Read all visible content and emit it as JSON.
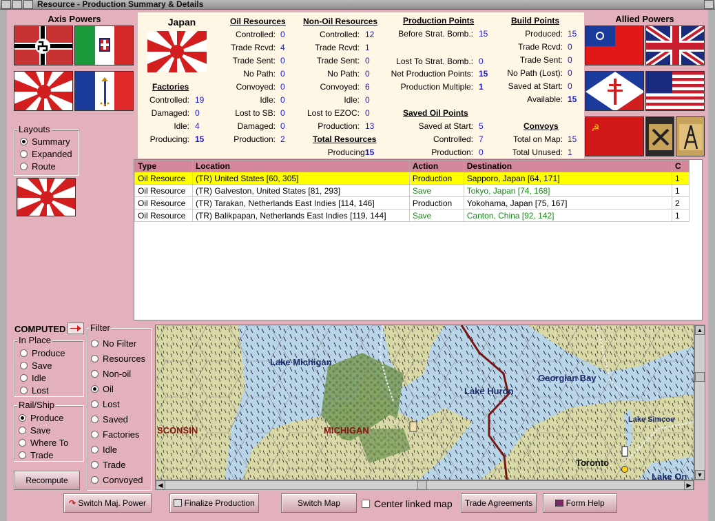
{
  "window": {
    "title": "Resource - Production Summary & Details"
  },
  "axis": {
    "header": "Axis Powers"
  },
  "allied": {
    "header": "Allied Powers"
  },
  "nation": {
    "name": "Japan"
  },
  "layouts": {
    "title": "Layouts",
    "options": [
      "Summary",
      "Expanded",
      "Route"
    ],
    "selected": 0
  },
  "factories": {
    "title": "Factories",
    "rows": [
      {
        "label": "Controlled:",
        "value": "19"
      },
      {
        "label": "Damaged:",
        "value": "0"
      },
      {
        "label": "Idle:",
        "value": "4"
      },
      {
        "label": "Producing:",
        "value": "15"
      }
    ]
  },
  "oil": {
    "title": "Oil Resources",
    "rows": [
      {
        "label": "Controlled:",
        "value": "0"
      },
      {
        "label": "Trade Rcvd:",
        "value": "4"
      },
      {
        "label": "Trade Sent:",
        "value": "0"
      },
      {
        "label": "No Path:",
        "value": "0"
      },
      {
        "label": "Convoyed:",
        "value": "0"
      },
      {
        "label": "Idle:",
        "value": "0"
      },
      {
        "label": "Lost to SB:",
        "value": "0"
      },
      {
        "label": "Damaged:",
        "value": "0"
      },
      {
        "label": "Production:",
        "value": "2"
      }
    ]
  },
  "nonoil": {
    "title": "Non-Oil Resources",
    "rows": [
      {
        "label": "Controlled:",
        "value": "12"
      },
      {
        "label": "Trade Rcvd:",
        "value": "1"
      },
      {
        "label": "Trade Sent:",
        "value": "0"
      },
      {
        "label": "No Path:",
        "value": "0"
      },
      {
        "label": "Convoyed:",
        "value": "6"
      },
      {
        "label": "Idle:",
        "value": "0"
      },
      {
        "label": "Lost to EZOC:",
        "value": "0"
      },
      {
        "label": "Production:",
        "value": "13"
      }
    ]
  },
  "total": {
    "title": "Total Resources",
    "label": "Producing:",
    "value": "15"
  },
  "prodpoints": {
    "title": "Production Points",
    "rows": [
      {
        "label": "Before Strat. Bomb.:",
        "value": "15"
      },
      {
        "label": "Lost To Strat. Bomb.:",
        "value": "0"
      },
      {
        "label": "Net Production Points:",
        "value": "15"
      },
      {
        "label": "Production Multiple:",
        "value": "1"
      }
    ]
  },
  "savedoil": {
    "title": "Saved Oil Points",
    "rows": [
      {
        "label": "Saved at Start:",
        "value": "5"
      },
      {
        "label": "Controlled:",
        "value": "7"
      },
      {
        "label": "Production:",
        "value": "0"
      }
    ]
  },
  "buildpoints": {
    "title": "Build Points",
    "rows": [
      {
        "label": "Produced:",
        "value": "15"
      },
      {
        "label": "Trade Rcvd:",
        "value": "0"
      },
      {
        "label": "Trade Sent:",
        "value": "0"
      },
      {
        "label": "No Path (Lost):",
        "value": "0"
      },
      {
        "label": "Saved at Start:",
        "value": "0"
      },
      {
        "label": "Available:",
        "value": "15"
      }
    ]
  },
  "convoys": {
    "title": "Convoys",
    "rows": [
      {
        "label": "Total on Map:",
        "value": "15"
      },
      {
        "label": "Total Unused:",
        "value": "1"
      }
    ]
  },
  "table": {
    "headers": [
      "Type",
      "Location",
      "Action",
      "Destination",
      "C"
    ],
    "rows": [
      {
        "type": "Oil Resource",
        "location": "(TR) United States [60, 305]",
        "action": "Production",
        "destination": "Sapporo, Japan [64, 171]",
        "c": "1",
        "selected": true,
        "green": false
      },
      {
        "type": "Oil Resource",
        "location": "(TR) Galveston, United States [81, 293]",
        "action": "Save",
        "destination": "Tokyo, Japan [74, 168]",
        "c": "1",
        "selected": false,
        "green": true
      },
      {
        "type": "Oil Resource",
        "location": "(TR) Tarakan, Netherlands East Indies [114, 146]",
        "action": "Production",
        "destination": "Yokohama, Japan [75, 167]",
        "c": "2",
        "selected": false,
        "green": false
      },
      {
        "type": "Oil Resource",
        "location": "(TR) Balikpapan, Netherlands East Indies [119, 144]",
        "action": "Save",
        "destination": "Canton, China [92, 142]",
        "c": "1",
        "selected": false,
        "green": true
      }
    ]
  },
  "computed": {
    "label": "COMPUTED"
  },
  "inplace": {
    "title": "In Place",
    "options": [
      "Produce",
      "Save",
      "Idle",
      "Lost"
    ]
  },
  "railship": {
    "title": "Rail/Ship",
    "options": [
      "Produce",
      "Save",
      "Where To",
      "Trade"
    ],
    "selected": 0
  },
  "filter": {
    "title": "Filter",
    "options": [
      "No Filter",
      "Resources",
      "Non-oil",
      "Oil",
      "Lost",
      "Saved",
      "Factories",
      "Idle",
      "Trade",
      "Convoyed"
    ],
    "selected": 3
  },
  "recompute": {
    "label": "Recompute"
  },
  "map": {
    "labels": [
      "Lake Michigan",
      "Lake Huron",
      "Georgian Bay",
      "Lake Simcoe",
      "SCONSIN",
      "MICHIGAN",
      "Toronto",
      "Lake On"
    ]
  },
  "bottom": {
    "switch_power": "Switch Maj. Power",
    "finalize": "Finalize Production",
    "switch_map": "Switch Map",
    "center_linked": "Center linked map",
    "trade": "Trade Agreements",
    "help": "Form Help"
  },
  "colors": {
    "pink": "#e3b1bb",
    "header_pink": "#d4869b",
    "value_blue": "#1a1acc",
    "selected_row": "#ffff00",
    "save_green": "#1a8a1a",
    "water": "#b8d4e6",
    "land": "#d9d9a8"
  }
}
